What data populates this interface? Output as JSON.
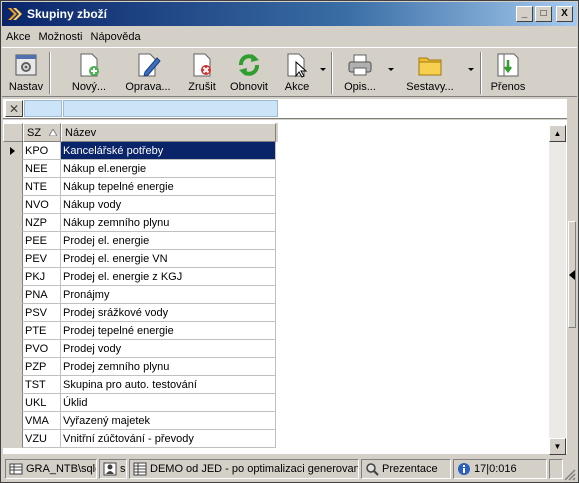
{
  "window": {
    "title": "Skupiny zboží"
  },
  "title_buttons": {
    "minimize": "_",
    "maximize": "□",
    "close": "X"
  },
  "menu": [
    "Akce",
    "Možnosti",
    "Nápověda"
  ],
  "toolbar": {
    "nastav": "Nastav",
    "novy": "Nový...",
    "oprava": "Oprava...",
    "zrusit": "Zrušit",
    "obnovit": "Obnovit",
    "akce": "Akce",
    "opis": "Opis...",
    "sestavy": "Sestavy...",
    "prenos": "Přenos"
  },
  "filter": {
    "clear": "✕"
  },
  "grid": {
    "columns": [
      "SZ",
      "Název"
    ],
    "rows": [
      {
        "sz": "KPO",
        "name": "Kancelářské potřeby"
      },
      {
        "sz": "NEE",
        "name": "Nákup el.energie"
      },
      {
        "sz": "NTE",
        "name": "Nákup tepelné energie"
      },
      {
        "sz": "NVO",
        "name": "Nákup vody"
      },
      {
        "sz": "NZP",
        "name": "Nákup zemního plynu"
      },
      {
        "sz": "PEE",
        "name": "Prodej el. energie"
      },
      {
        "sz": "PEV",
        "name": "Prodej el. energie VN"
      },
      {
        "sz": "PKJ",
        "name": "Prodej el. energie z KGJ"
      },
      {
        "sz": "PNA",
        "name": "Pronájmy"
      },
      {
        "sz": "PSV",
        "name": "Prodej srážkové vody"
      },
      {
        "sz": "PTE",
        "name": "Prodej tepelné energie"
      },
      {
        "sz": "PVO",
        "name": "Prodej vody"
      },
      {
        "sz": "PZP",
        "name": "Prodej zemního plynu"
      },
      {
        "sz": "TST",
        "name": "Skupina pro auto. testování"
      },
      {
        "sz": "UKL",
        "name": "Úklid"
      },
      {
        "sz": "VMA",
        "name": "Vyřazený majetek"
      },
      {
        "sz": "VZU",
        "name": "Vnitřní zúčtování - převody"
      }
    ]
  },
  "status": {
    "db": "GRA_NTB\\sqle",
    "user": "s",
    "company": "DEMO od JED - po optimalizaci generovani f",
    "mode": "Prezentace",
    "info": "17|0:016"
  }
}
